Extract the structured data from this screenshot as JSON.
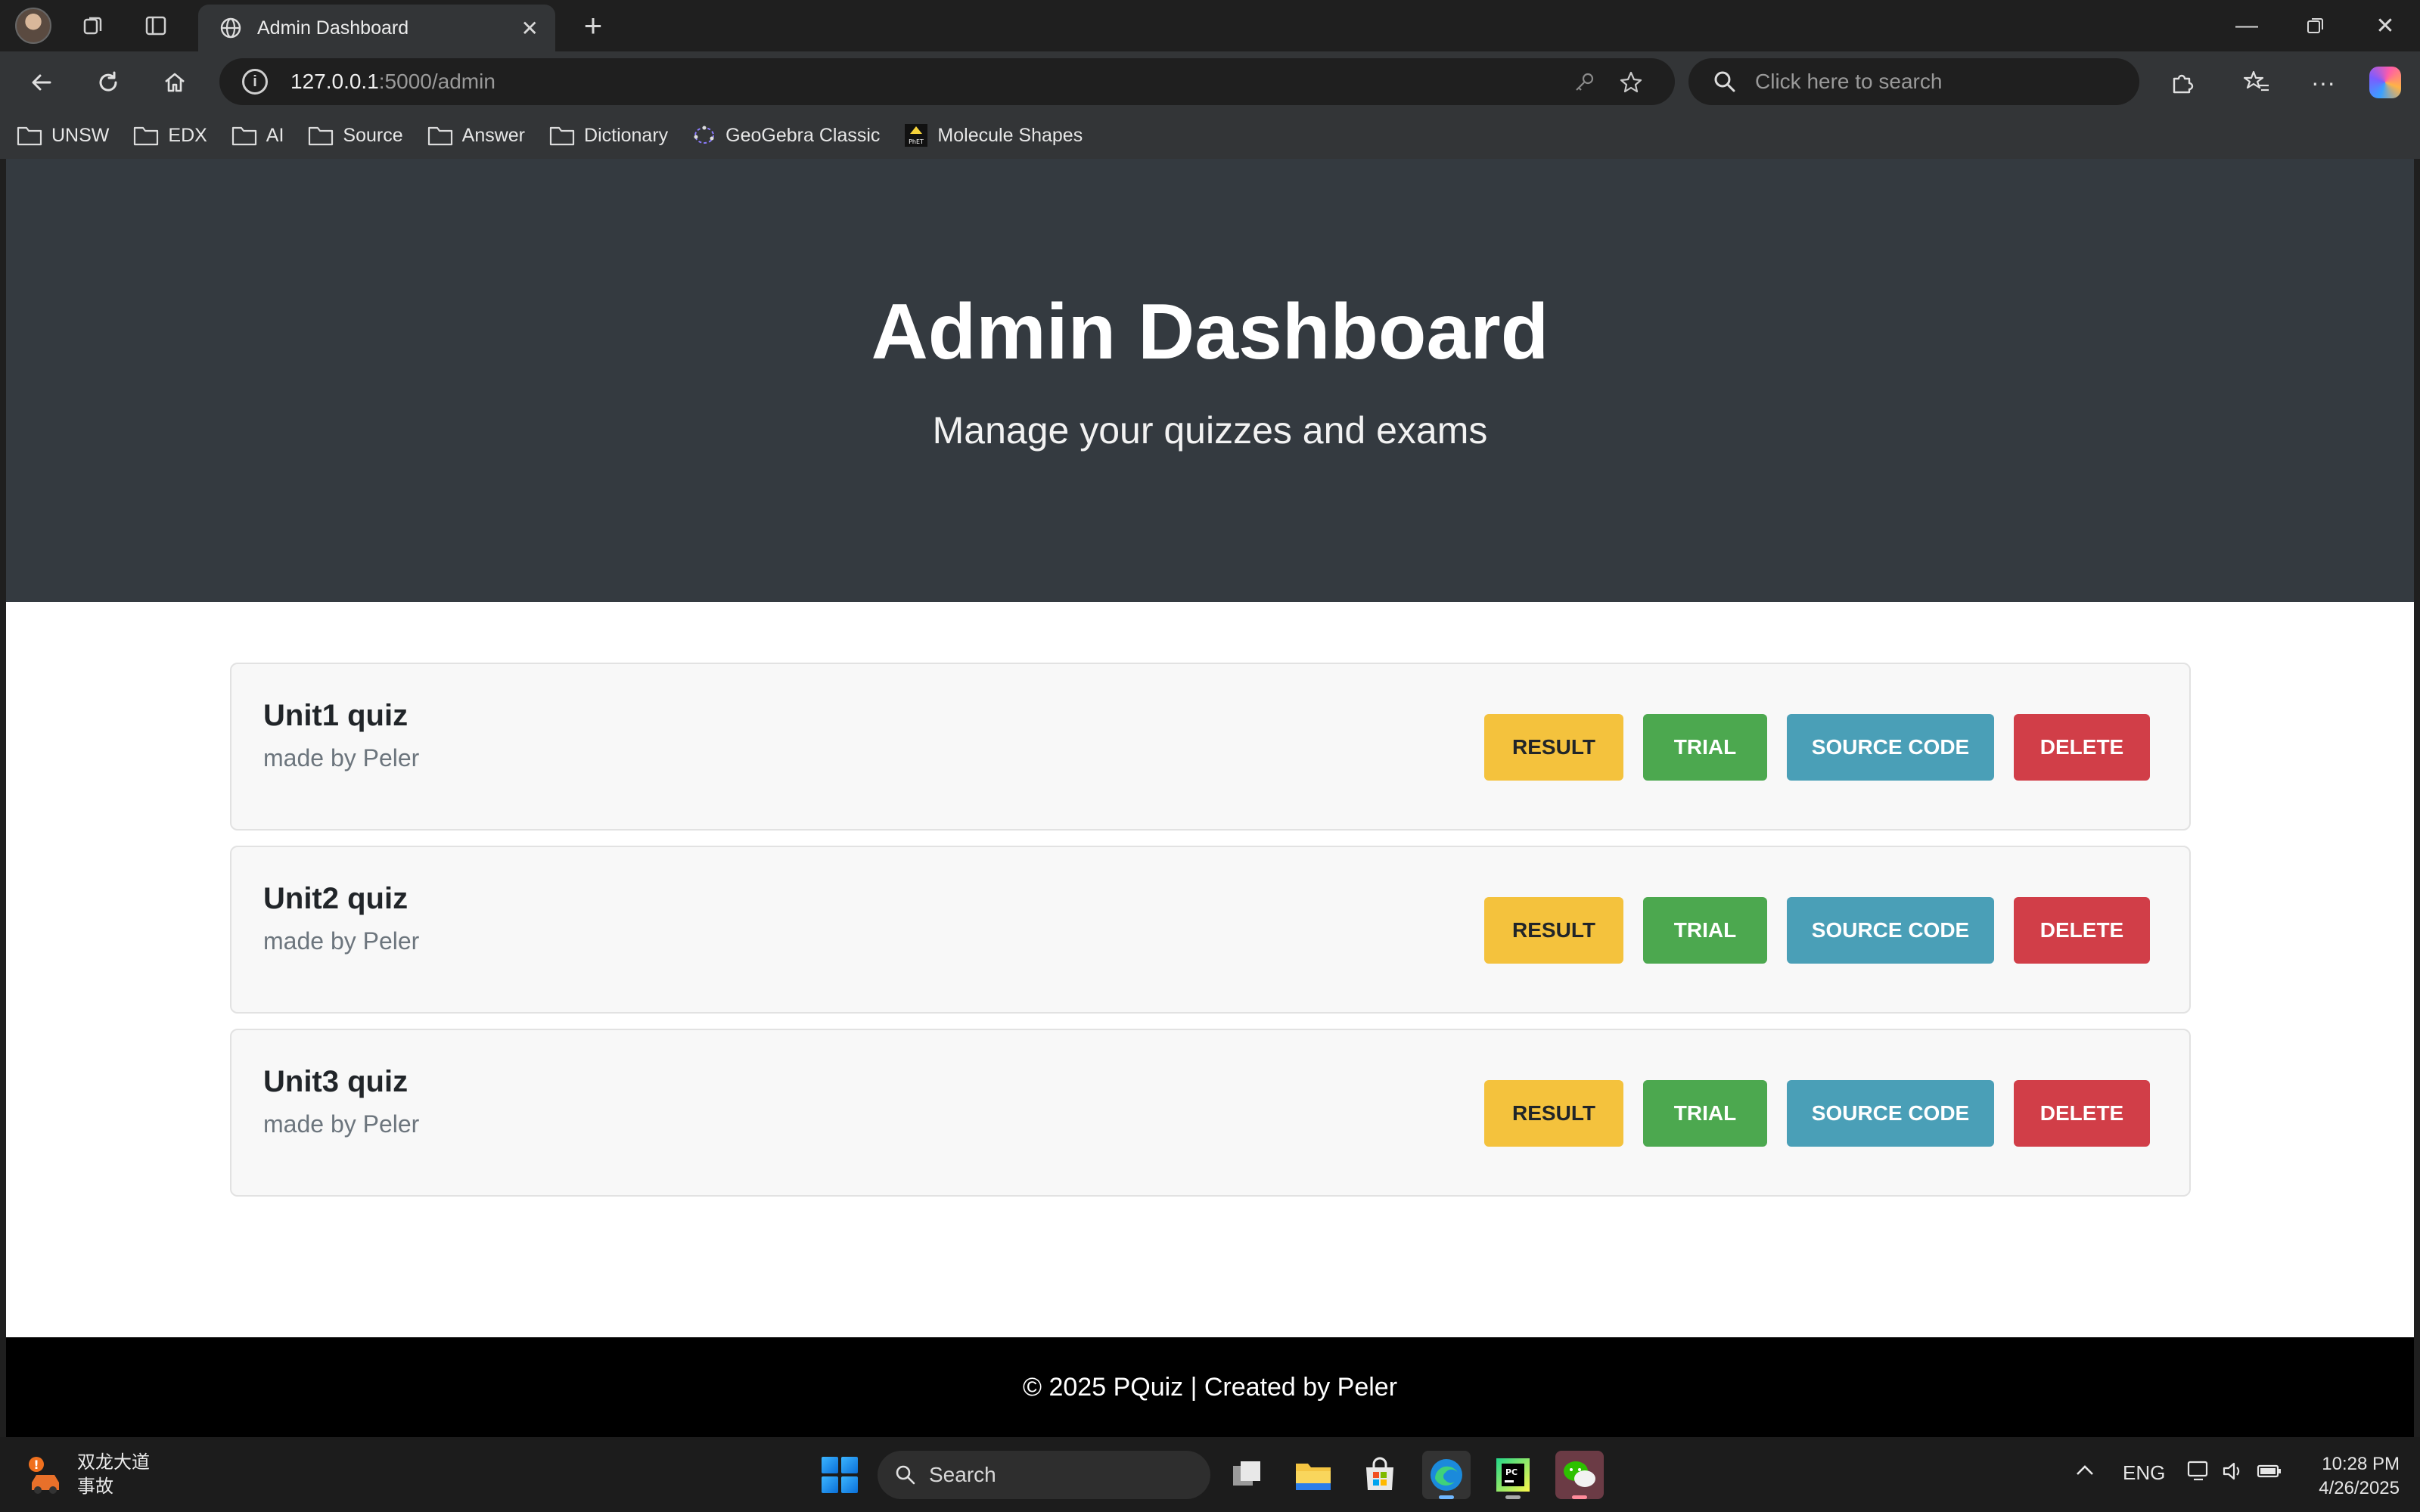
{
  "browser": {
    "tab_title": "Admin Dashboard",
    "url_host": "127.0.0.1",
    "url_path": ":5000/admin",
    "search_placeholder": "Click here to search",
    "bookmarks": [
      {
        "label": "UNSW",
        "icon": "folder-icon"
      },
      {
        "label": "EDX",
        "icon": "folder-icon"
      },
      {
        "label": "AI",
        "icon": "folder-icon"
      },
      {
        "label": "Source",
        "icon": "folder-icon"
      },
      {
        "label": "Answer",
        "icon": "folder-icon"
      },
      {
        "label": "Dictionary",
        "icon": "folder-icon"
      },
      {
        "label": "GeoGebra Classic",
        "icon": "geogebra-icon"
      },
      {
        "label": "Molecule Shapes",
        "icon": "phet-icon"
      }
    ]
  },
  "page": {
    "hero": {
      "title": "Admin Dashboard",
      "subtitle": "Manage your quizzes and exams"
    },
    "quizzes": [
      {
        "title": "Unit1 quiz",
        "author": "made by Peler"
      },
      {
        "title": "Unit2 quiz",
        "author": "made by Peler"
      },
      {
        "title": "Unit3 quiz",
        "author": "made by Peler"
      }
    ],
    "buttons": {
      "result": "RESULT",
      "trial": "TRIAL",
      "source": "SOURCE CODE",
      "delete": "DELETE"
    },
    "footer": "© 2025 PQuiz | Created by Peler"
  },
  "colors": {
    "hero_bg": "#343a40",
    "result": "#f4c23d",
    "trial": "#4ca84f",
    "source": "#4a9fb7",
    "delete": "#d13e48"
  },
  "taskbar": {
    "weather_line1": "双龙大道",
    "weather_line2": "事故",
    "search_label": "Search",
    "language": "ENG",
    "time": "10:28 PM",
    "date": "4/26/2025"
  }
}
